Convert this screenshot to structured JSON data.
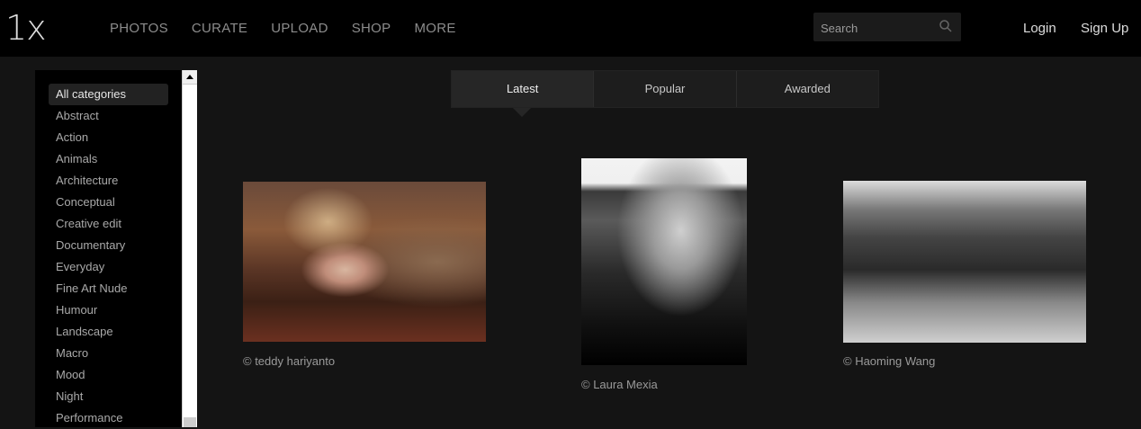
{
  "logo": "1x",
  "nav": {
    "items": [
      "PHOTOS",
      "CURATE",
      "UPLOAD",
      "SHOP",
      "MORE"
    ]
  },
  "search": {
    "placeholder": "Search"
  },
  "auth": {
    "login": "Login",
    "signup": "Sign Up"
  },
  "sidebar": {
    "categories": [
      "All categories",
      "Abstract",
      "Action",
      "Animals",
      "Architecture",
      "Conceptual",
      "Creative edit",
      "Documentary",
      "Everyday",
      "Fine Art Nude",
      "Humour",
      "Landscape",
      "Macro",
      "Mood",
      "Night",
      "Performance"
    ],
    "active": "All categories"
  },
  "tabs": {
    "items": [
      "Latest",
      "Popular",
      "Awarded"
    ],
    "active": "Latest"
  },
  "photos": [
    {
      "credit": "© teddy hariyanto"
    },
    {
      "credit": "© Laura Mexia"
    },
    {
      "credit": "© Haoming Wang"
    }
  ],
  "colors": {
    "topbar": "#000000",
    "page_bg": "#141414",
    "tab_active": "#262626"
  }
}
